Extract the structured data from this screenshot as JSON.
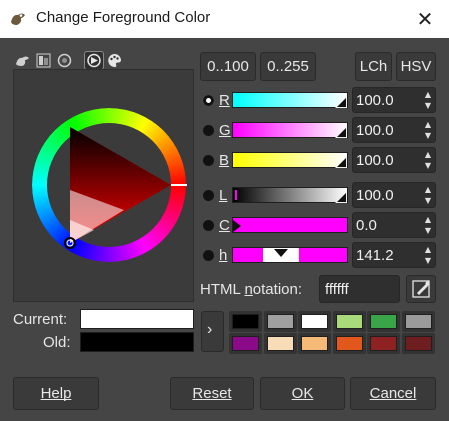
{
  "window": {
    "title": "Change Foreground Color",
    "close_glyph": "✕",
    "icon": "gimp-wilber-icon"
  },
  "selectors": {
    "tabs": [
      "gimp-icon",
      "scales-icon",
      "watercolor-icon",
      "wheel-icon",
      "palette-icon"
    ],
    "active": "wheel-icon"
  },
  "buttons_top": {
    "range_100": "0..100",
    "range_255": "0..255",
    "lch": "LCh",
    "hsv": "HSV"
  },
  "channels": [
    {
      "key": "R",
      "value": "100.0",
      "selected": true
    },
    {
      "key": "G",
      "value": "100.0",
      "selected": false
    },
    {
      "key": "B",
      "value": "100.0",
      "selected": false
    },
    {
      "key": "L",
      "value": "100.0",
      "selected": false
    },
    {
      "key": "C",
      "value": "0.0",
      "selected": false
    },
    {
      "key": "h",
      "value": "141.2",
      "selected": false
    }
  ],
  "html_notation": {
    "label_pre": "HTML ",
    "label_u": "n",
    "label_post": "otation:",
    "value": "ffffff"
  },
  "current": {
    "label": "Current:",
    "color": "#ffffff"
  },
  "old": {
    "label": "Old:",
    "color": "#000000"
  },
  "history": [
    "#000000",
    "#a0a0a0",
    "#ffffff",
    "#a8d97a",
    "#3aa548",
    "#9a9a9a",
    "#8a0a8a",
    "#f8dcb8",
    "#f6ba78",
    "#e2581c",
    "#8e2222",
    "#6e1e1e"
  ],
  "footer": {
    "help": "Help",
    "reset": "Reset",
    "ok": "OK",
    "cancel": "Cancel"
  }
}
